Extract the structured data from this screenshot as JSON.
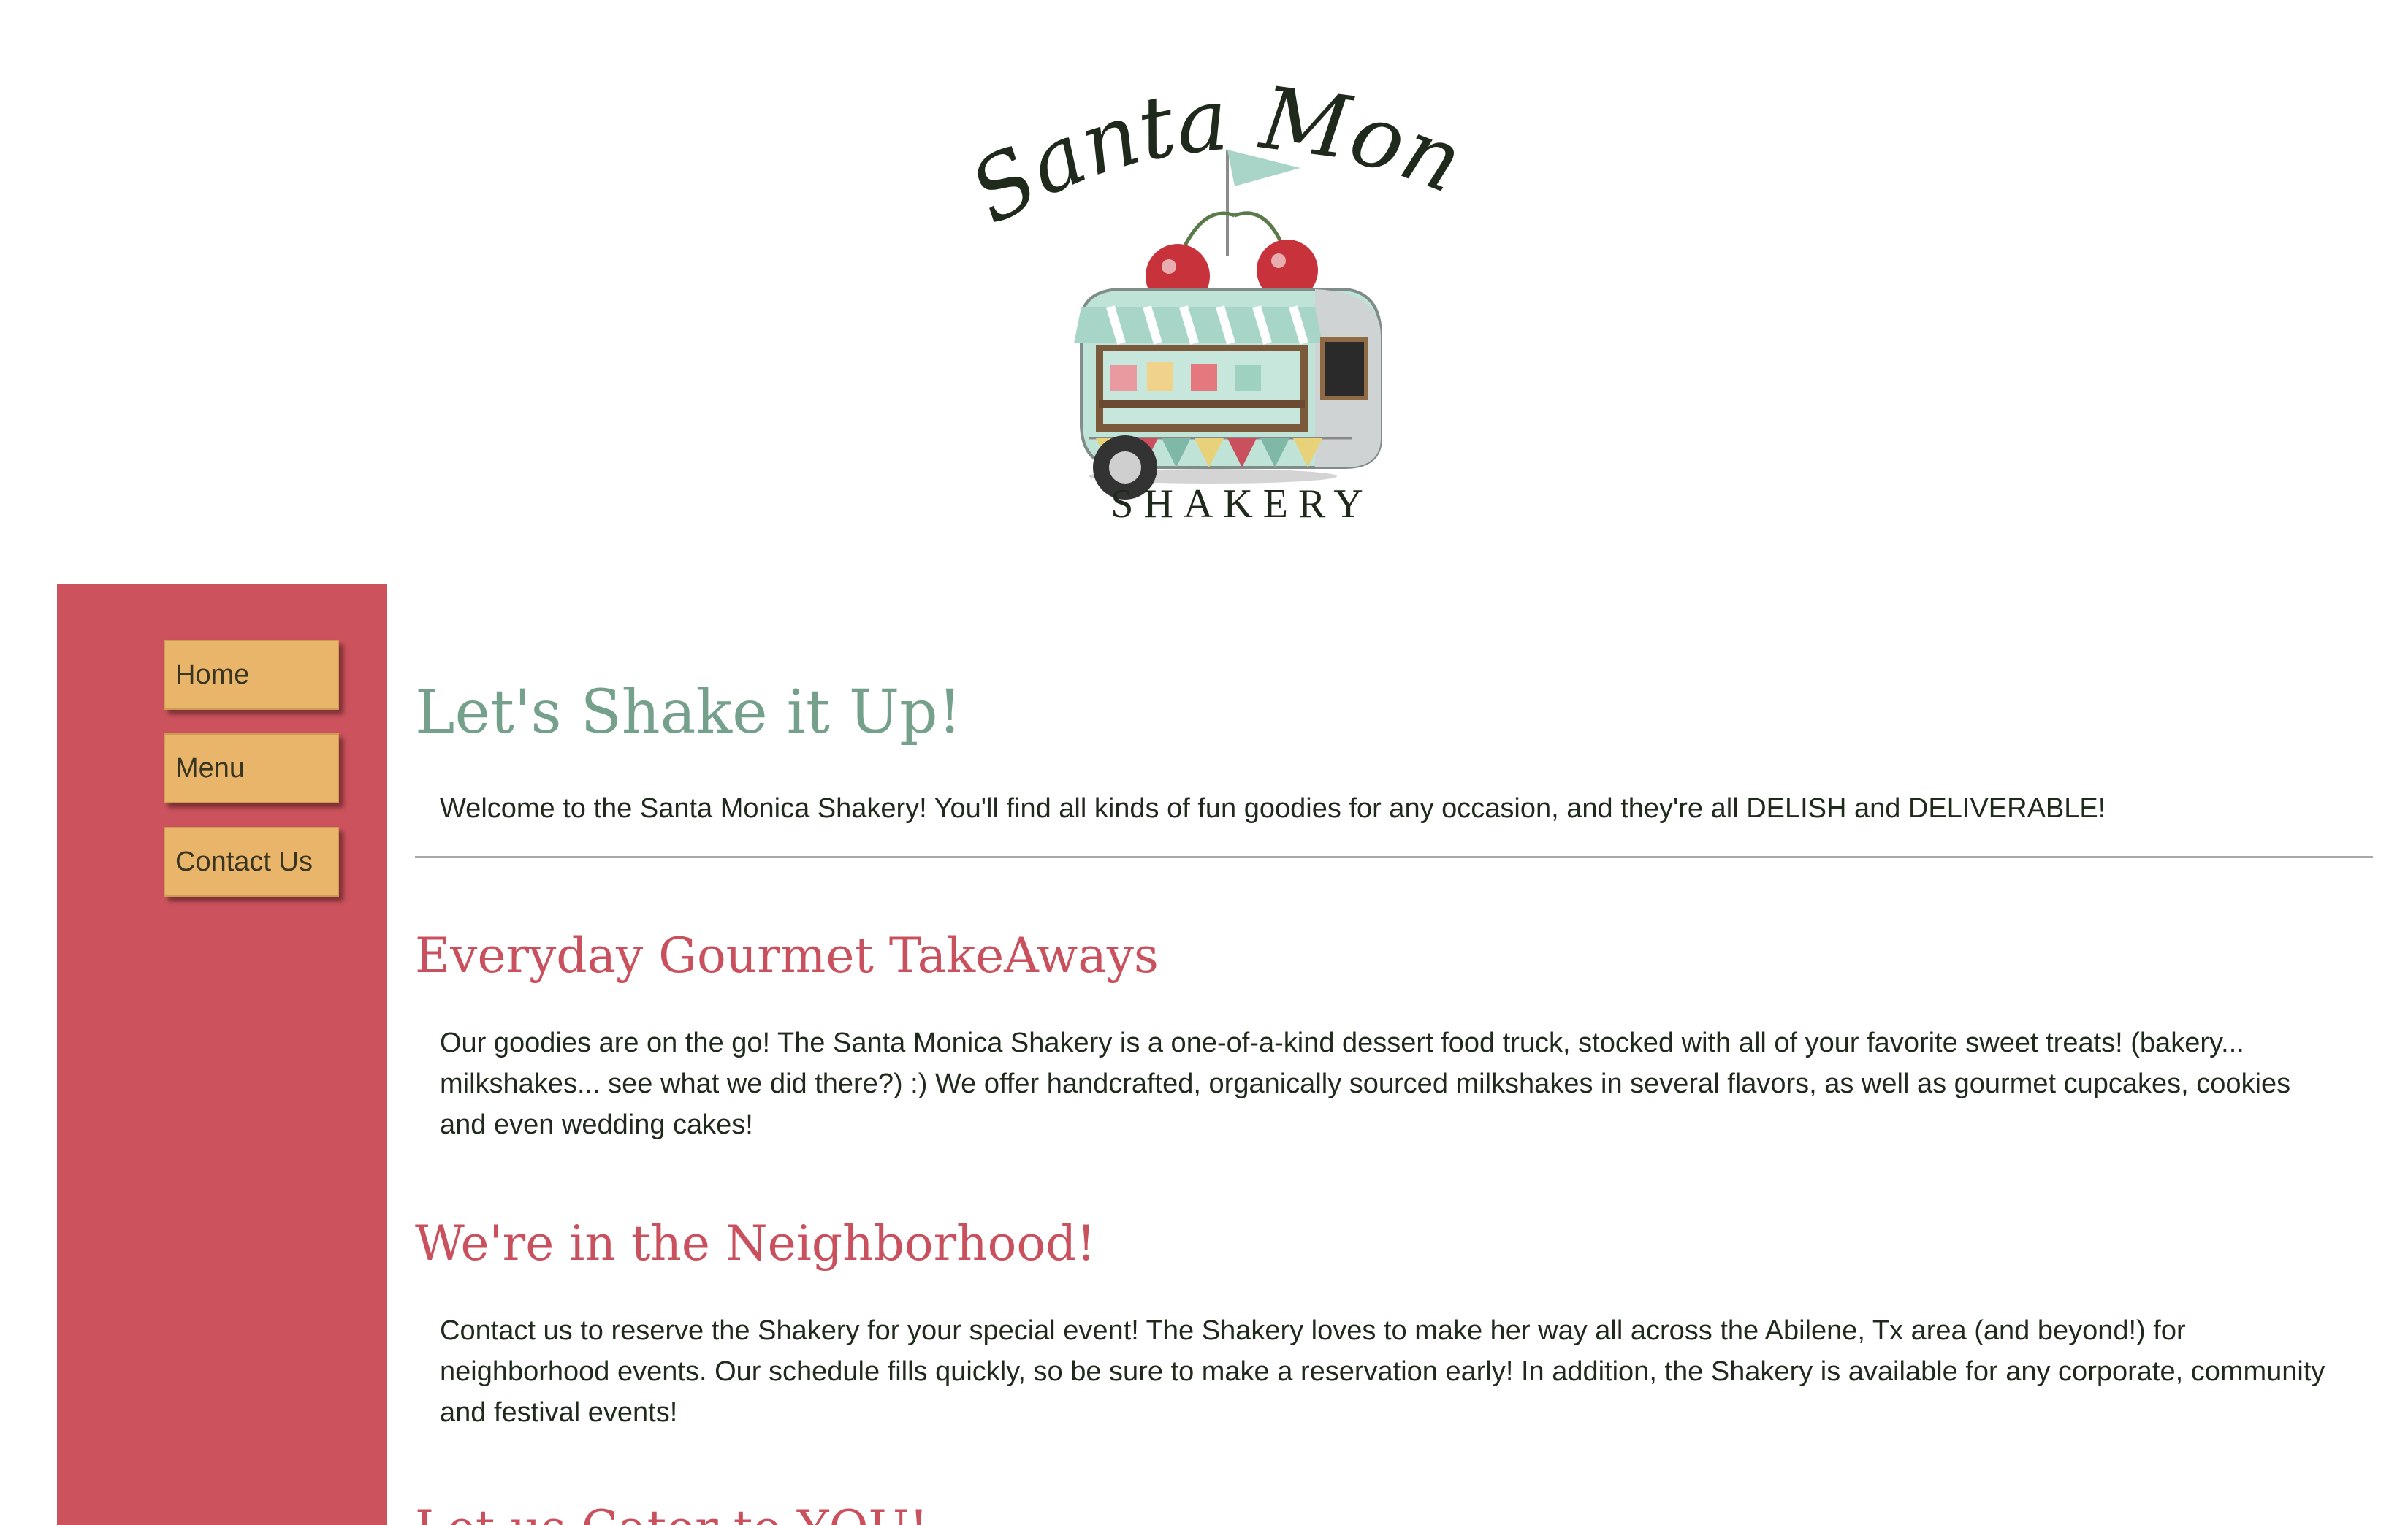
{
  "logo": {
    "line1": "Santa Monica",
    "line2": "SHAKERY"
  },
  "nav": {
    "items": [
      {
        "label": "Home"
      },
      {
        "label": "Menu"
      },
      {
        "label": "Contact Us"
      }
    ]
  },
  "main": {
    "title": "Let's Shake it Up!",
    "welcome": "Welcome to the Santa Monica Shakery! You'll find all kinds of fun goodies for any occasion, and they're all DELISH and DELIVERABLE!",
    "sections": [
      {
        "heading": "Everyday Gourmet TakeAways",
        "body": "Our goodies are on the go! The Santa Monica Shakery is a one-of-a-kind dessert food truck, stocked with all of your favorite sweet treats! (bakery... milkshakes... see what we did there?) :) We offer handcrafted, organically sourced milkshakes in several flavors, as well as gourmet cupcakes, cookies and even wedding cakes!"
      },
      {
        "heading": "We're in the Neighborhood!",
        "body": "Contact us to reserve the Shakery for your special event! The Shakery loves to make her way all across the Abilene, Tx area (and beyond!) for neighborhood events. Our schedule fills quickly, so be sure to make a reservation early! In addition, the Shakery is available for any corporate, community and festival events!"
      },
      {
        "heading": "Let us Cater to YOU!"
      }
    ]
  },
  "colors": {
    "sidebar": "#cc535e",
    "nav_button": "#e8b56b",
    "title": "#74a08c",
    "heading": "#c9505d",
    "text": "#1f2a1c"
  }
}
